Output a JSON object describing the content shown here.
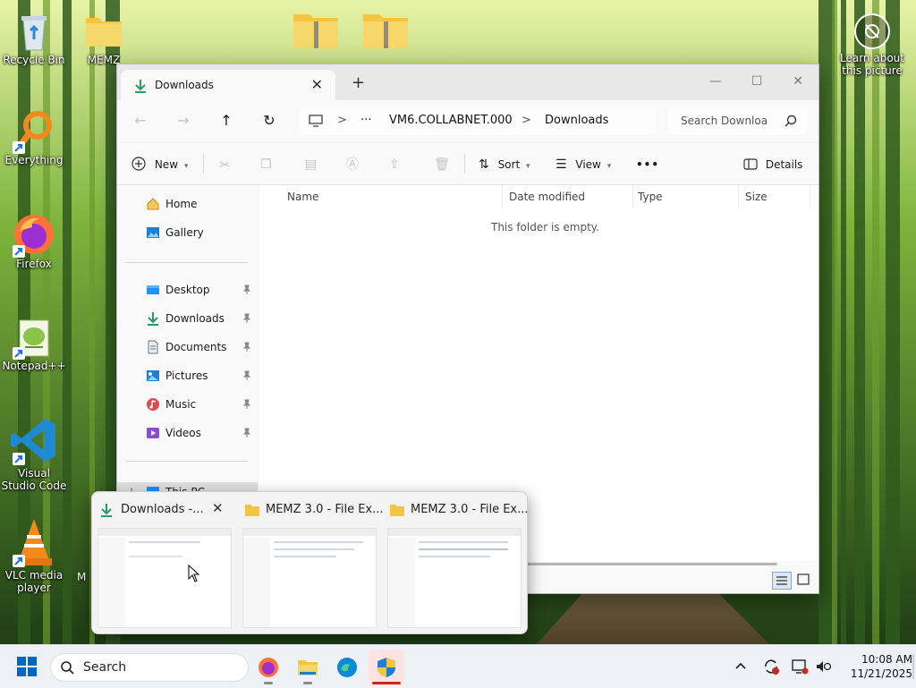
{
  "desktop": {
    "icons": [
      {
        "name": "recycle-bin",
        "label": "Recycle Bin"
      },
      {
        "name": "memz",
        "label": "MEMZ"
      },
      {
        "name": "everything",
        "label": "Everything"
      },
      {
        "name": "firefox",
        "label": "Firefox"
      },
      {
        "name": "notepad-plus-plus",
        "label": "Notepad++"
      },
      {
        "name": "visual-studio-code",
        "label": "Visual Studio Code"
      },
      {
        "name": "vlc-media-player",
        "label": "VLC media player"
      },
      {
        "name": "learn-about-picture",
        "label": "Learn about this picture"
      }
    ],
    "hidden_label_m": "M"
  },
  "explorer": {
    "tab_title": "Downloads",
    "new_tab": "+",
    "controls": {
      "minimize": "—",
      "maximize": "☐",
      "close": "✕"
    },
    "nav": {
      "back": "←",
      "forward": "→",
      "up": "↑",
      "refresh": "↻"
    },
    "breadcrumb": [
      "VM6.COLLABNET.000",
      "Downloads"
    ],
    "breadcrumb_sep": ">",
    "breadcrumb_more": "···",
    "search_placeholder": "Search Downloa",
    "toolbar": {
      "new": "New",
      "sort": "Sort",
      "view": "View",
      "more": "•••",
      "details": "Details"
    },
    "sidebar": {
      "top": [
        {
          "label": "Home",
          "icon": "home-icon"
        },
        {
          "label": "Gallery",
          "icon": "gallery-icon"
        }
      ],
      "pinned": [
        {
          "label": "Desktop",
          "icon": "desktop-icon",
          "color": "#1e90ff"
        },
        {
          "label": "Downloads",
          "icon": "downloads-icon",
          "color": "#2b9a66"
        },
        {
          "label": "Documents",
          "icon": "documents-icon",
          "color": "#6b7785"
        },
        {
          "label": "Pictures",
          "icon": "pictures-icon",
          "color": "#1e7fd6"
        },
        {
          "label": "Music",
          "icon": "music-icon",
          "color": "#e0474f"
        },
        {
          "label": "Videos",
          "icon": "videos-icon",
          "color": "#8a4bd6"
        }
      ],
      "this_pc": "This PC"
    },
    "columns": [
      "Name",
      "Date modified",
      "Type",
      "Size"
    ],
    "empty_message": "This folder is empty."
  },
  "preview": {
    "windows": [
      {
        "title": "Downloads -...",
        "icon": "downloads-icon"
      },
      {
        "title": "MEMZ 3.0 - File Ex...",
        "icon": "folder-icon"
      },
      {
        "title": "MEMZ 3.0 - File Ex...",
        "icon": "folder-icon"
      }
    ],
    "close": "✕"
  },
  "taskbar": {
    "search_label": "Search",
    "apps": [
      "firefox",
      "file-explorer",
      "edge",
      "windows-security"
    ],
    "clock": {
      "time": "10:08 AM",
      "date": "11/21/2025"
    },
    "colors": {
      "accent": "#0067c0",
      "security_active": "#c42b1c"
    }
  }
}
